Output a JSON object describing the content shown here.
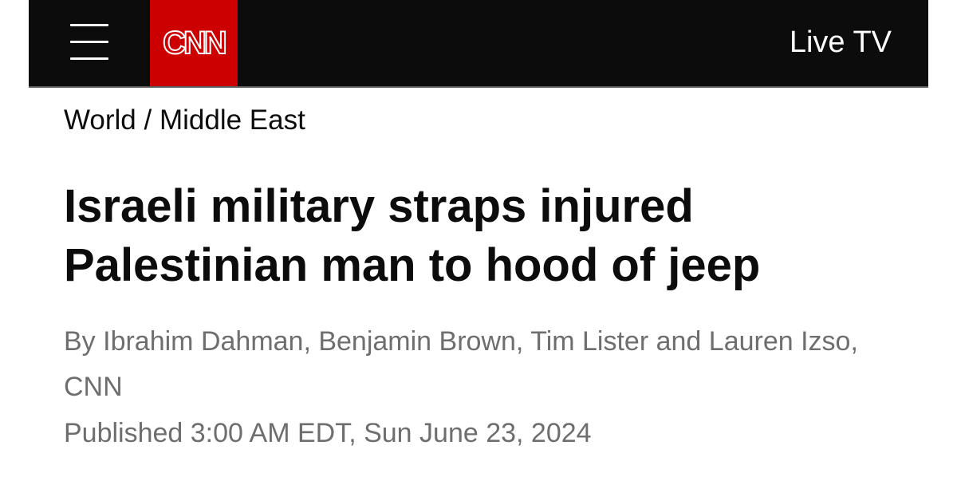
{
  "header": {
    "logo_text": "CNN",
    "live_tv_label": "Live TV",
    "menu_icon": "hamburger-menu-icon",
    "colors": {
      "bar_background": "#0c0c0c",
      "logo_red": "#cc0000"
    }
  },
  "breadcrumb": {
    "section": "World",
    "separator": " / ",
    "subsection": "Middle East"
  },
  "article": {
    "headline": "Israeli military straps injured Palestinian man to hood of jeep",
    "byline": "By Ibrahim Dahman, Benjamin Brown, Tim Lister and Lauren Izso, CNN",
    "published": "Published 3:00 AM EDT, Sun June 23, 2024"
  }
}
